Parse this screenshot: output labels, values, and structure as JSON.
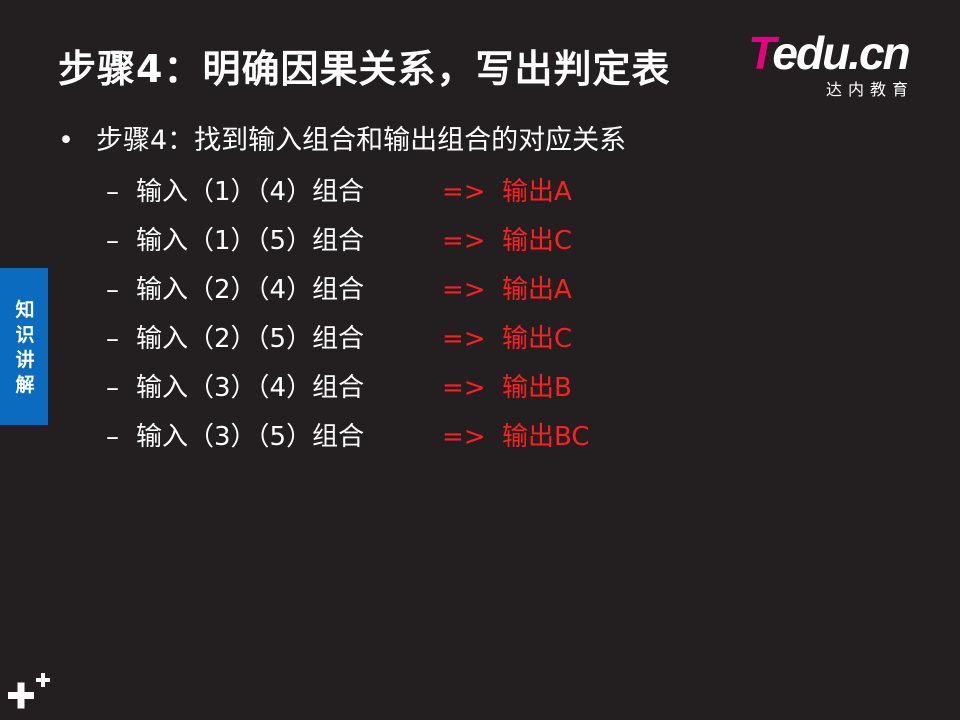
{
  "title": "步骤4：明确因果关系，写出判定表",
  "logo": {
    "t": "T",
    "rest": "edu.cn",
    "sub": "达内教育"
  },
  "bullet": "步骤4：找到输入组合和输出组合的对应关系",
  "dash": "–",
  "arrow": "=>",
  "rows": [
    {
      "input": "输入（1）（4）组合",
      "output": "输出A"
    },
    {
      "input": "输入（1）（5）组合",
      "output": "输出C"
    },
    {
      "input": "输入（2）（4）组合",
      "output": "输出A"
    },
    {
      "input": "输入（2）（5）组合",
      "output": "输出C"
    },
    {
      "input": "输入（3）（4）组合",
      "output": "输出B"
    },
    {
      "input": "输入（3）（5）组合",
      "output": "输出BC"
    }
  ],
  "side_tab": "知识讲解",
  "colors": {
    "background": "#231f20",
    "accent_red": "#ff1f1f",
    "tab_blue": "#0a6bbf",
    "logo_magenta": "#e6007e"
  },
  "icons": {
    "bottom_left": "plus-icon"
  }
}
